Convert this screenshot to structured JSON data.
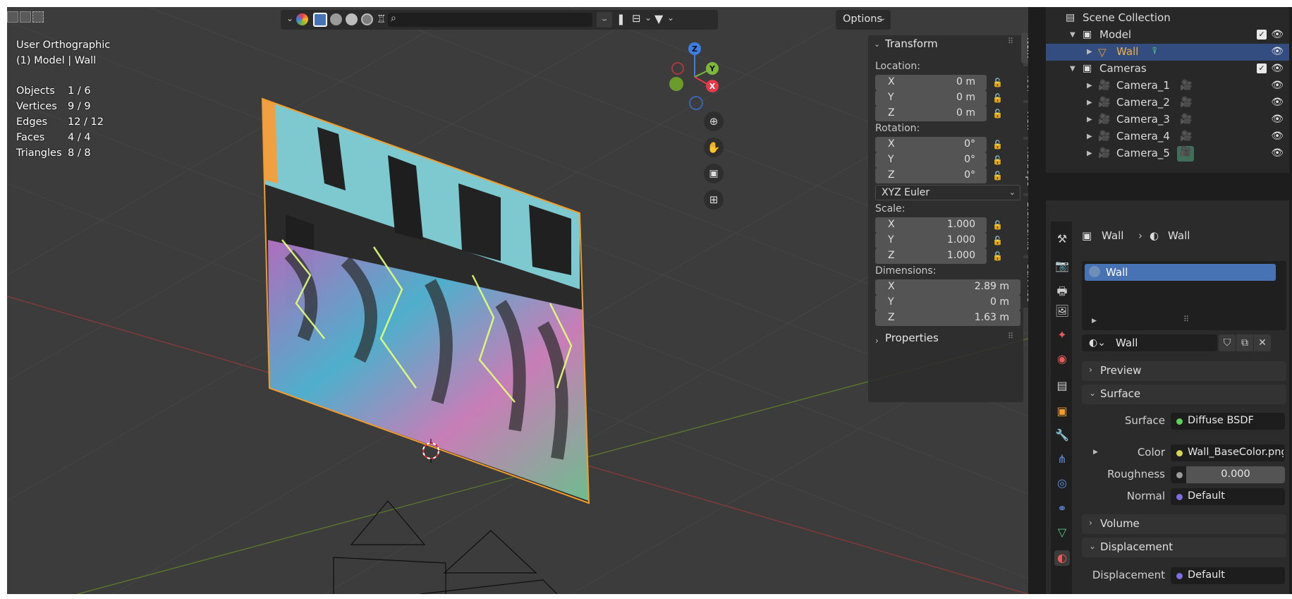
{
  "viewport": {
    "view_name": "User Orthographic",
    "context": "(1) Model | Wall",
    "stats": [
      {
        "label": "Objects",
        "value": "1 / 6"
      },
      {
        "label": "Vertices",
        "value": "9 / 9"
      },
      {
        "label": "Edges",
        "value": "12 / 12"
      },
      {
        "label": "Faces",
        "value": "4 / 4"
      },
      {
        "label": "Triangles",
        "value": "8 / 8"
      }
    ],
    "options_label": "Options",
    "gizmo_axes": {
      "x": "X",
      "y": "Y",
      "z": "Z"
    }
  },
  "npanel": {
    "transform_title": "Transform",
    "location_label": "Location:",
    "location": [
      {
        "axis": "X",
        "value": "0 m"
      },
      {
        "axis": "Y",
        "value": "0 m"
      },
      {
        "axis": "Z",
        "value": "0 m"
      }
    ],
    "rotation_label": "Rotation:",
    "rotation": [
      {
        "axis": "X",
        "value": "0°"
      },
      {
        "axis": "Y",
        "value": "0°"
      },
      {
        "axis": "Z",
        "value": "0°"
      }
    ],
    "rotation_mode": "XYZ Euler",
    "scale_label": "Scale:",
    "scale": [
      {
        "axis": "X",
        "value": "1.000"
      },
      {
        "axis": "Y",
        "value": "1.000"
      },
      {
        "axis": "Z",
        "value": "1.000"
      }
    ],
    "dimensions_label": "Dimensions:",
    "dimensions": [
      {
        "axis": "X",
        "value": "2.89 m"
      },
      {
        "axis": "Y",
        "value": "0 m"
      },
      {
        "axis": "Z",
        "value": "1.63 m"
      }
    ],
    "properties_title": "Properties"
  },
  "vtabs": [
    "Item",
    "Tool",
    "View",
    "HardOps",
    "BlenderKit",
    "Surf Ace"
  ],
  "outliner": {
    "root": "Scene Collection",
    "model": "Model",
    "wall": "Wall",
    "cameras": "Cameras",
    "camera_items": [
      "Camera_1",
      "Camera_2",
      "Camera_3",
      "Camera_4",
      "Camera_5"
    ]
  },
  "properties": {
    "breadcrumb_object": "Wall",
    "breadcrumb_material": "Wall",
    "material_slot": "Wall",
    "material_name": "Wall",
    "sections": {
      "preview": "Preview",
      "surface": "Surface",
      "volume": "Volume",
      "displacement": "Displacement"
    },
    "surface_label": "Surface",
    "surface_value": "Diffuse BSDF",
    "color_label": "Color",
    "color_value": "Wall_BaseColor.png",
    "roughness_label": "Roughness",
    "roughness_value": "0.000",
    "normal_label": "Normal",
    "normal_value": "Default",
    "displacement_label": "Displacement",
    "displacement_value": "Default"
  },
  "colors": {
    "selection_orange": "#f29c2b",
    "selected_row": "#334d80",
    "accent_blue": "#4772b3",
    "axis_red": "#e8394a",
    "axis_green": "#7eb83a",
    "axis_blue": "#3d7fe0"
  }
}
